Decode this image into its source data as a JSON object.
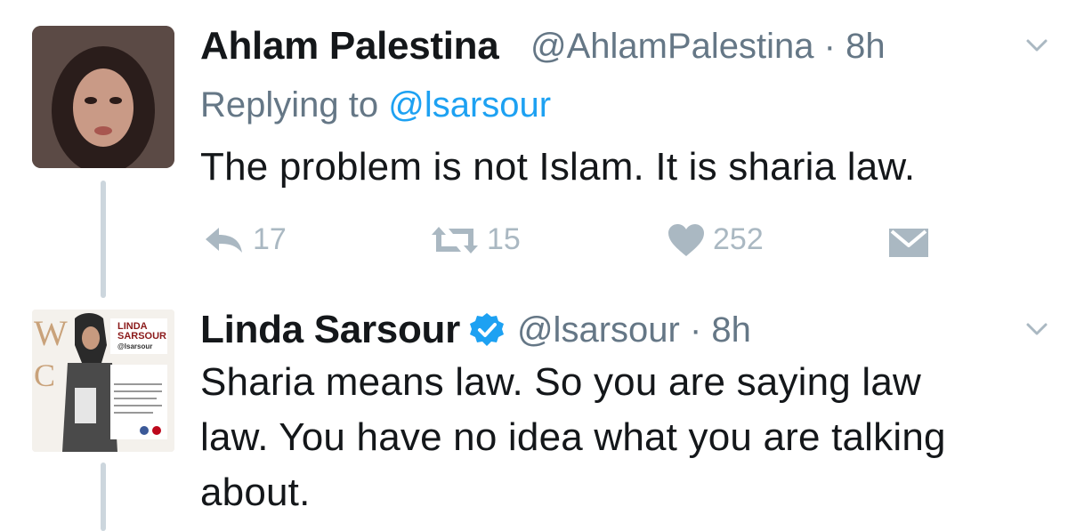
{
  "tweets": [
    {
      "name": "Ahlam Palestina",
      "handle": "@AhlamPalestina",
      "time": "8h",
      "replying_to_label": "Replying to",
      "replying_to_handle": "@lsarsour",
      "text": "The problem is not Islam. It is sharia law.",
      "actions": {
        "reply_count": "17",
        "retweet_count": "15",
        "like_count": "252"
      }
    },
    {
      "name": "Linda Sarsour",
      "verified": true,
      "handle": "@lsarsour",
      "time": "8h",
      "text_lines": [
        "Sharia means law. So you are saying law",
        "law. You have no idea what you are talking",
        "about."
      ],
      "avatar_text": {
        "line1": "LINDA",
        "line2": "SARSOUR",
        "handle": "@lsarsour"
      }
    }
  ],
  "separator": "·",
  "colors": {
    "link": "#1da1f2",
    "muted": "#657786",
    "icon": "#aab8c2",
    "verified": "#1da1f2"
  },
  "icons": [
    "chevron-down-icon",
    "reply-icon",
    "retweet-icon",
    "heart-icon",
    "direct-message-icon",
    "verified-badge-icon"
  ]
}
